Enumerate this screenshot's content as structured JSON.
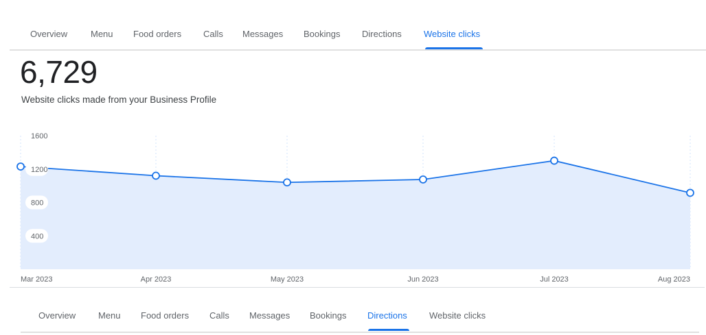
{
  "top_tabs": {
    "items": [
      {
        "label": "Overview"
      },
      {
        "label": "Menu"
      },
      {
        "label": "Food orders"
      },
      {
        "label": "Calls"
      },
      {
        "label": "Messages"
      },
      {
        "label": "Bookings"
      },
      {
        "label": "Directions"
      },
      {
        "label": "Website clicks"
      }
    ],
    "active": "Website clicks"
  },
  "summary": {
    "total": "6,729",
    "description": "Website clicks made from your Business Profile"
  },
  "chart_data": {
    "type": "area",
    "categories": [
      "Mar 2023",
      "Apr 2023",
      "May 2023",
      "Jun 2023",
      "Jul 2023",
      "Aug 2023"
    ],
    "values": [
      1230,
      1120,
      1040,
      1075,
      1300,
      915
    ],
    "y_ticks": [
      "1600",
      "1200",
      "800",
      "400"
    ],
    "ylim": [
      0,
      1600
    ],
    "grid": true,
    "colors": {
      "line": "#1a73e8",
      "fill": "#e3edfd"
    }
  },
  "bottom_tabs": {
    "items": [
      {
        "label": "Overview"
      },
      {
        "label": "Menu"
      },
      {
        "label": "Food orders"
      },
      {
        "label": "Calls"
      },
      {
        "label": "Messages"
      },
      {
        "label": "Bookings"
      },
      {
        "label": "Directions"
      },
      {
        "label": "Website clicks"
      }
    ],
    "active": "Directions"
  }
}
